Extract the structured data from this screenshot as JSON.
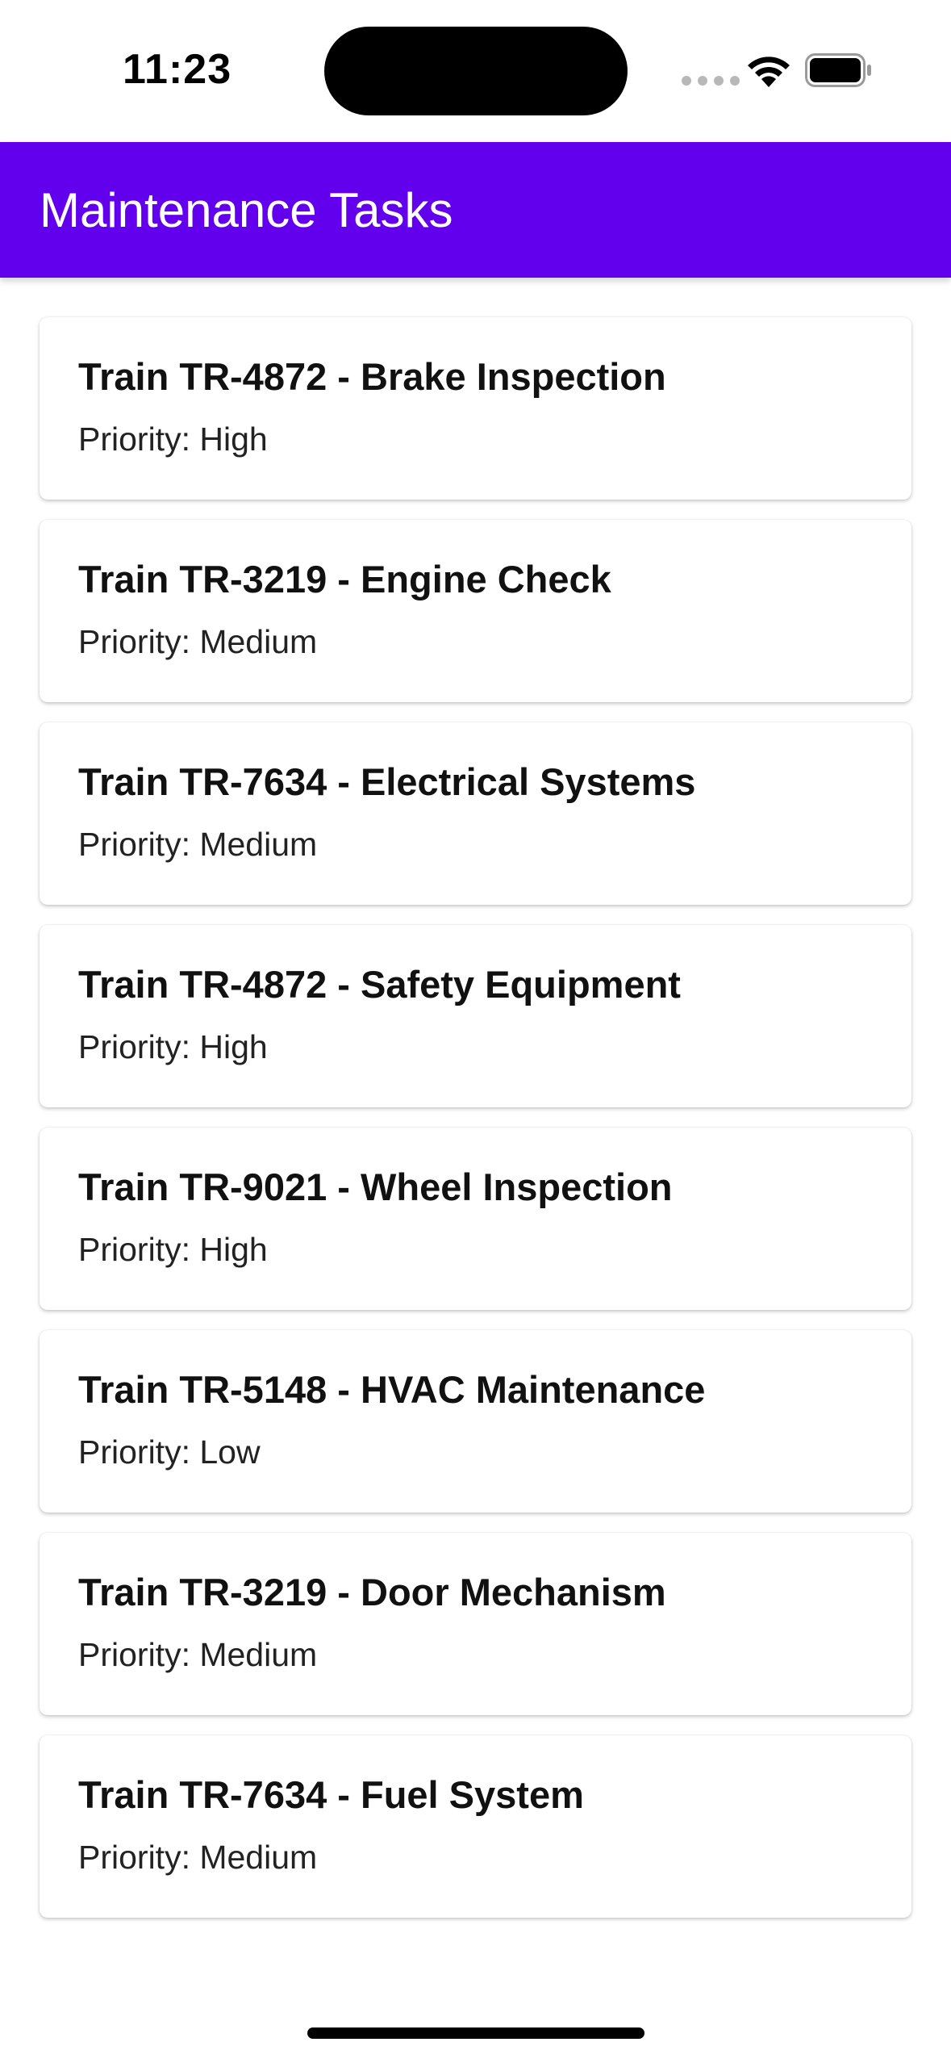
{
  "status_bar": {
    "time": "11:23",
    "icons": [
      "signal-dots-icon",
      "wifi-icon",
      "battery-icon"
    ]
  },
  "app_bar": {
    "title": "Maintenance Tasks",
    "color": "#6200ee"
  },
  "tasks": [
    {
      "title": "Train TR-4872 - Brake Inspection",
      "priority": "Priority: High"
    },
    {
      "title": "Train TR-3219 - Engine Check",
      "priority": "Priority: Medium"
    },
    {
      "title": "Train TR-7634 - Electrical Systems",
      "priority": "Priority: Medium"
    },
    {
      "title": "Train TR-4872 - Safety Equipment",
      "priority": "Priority: High"
    },
    {
      "title": "Train TR-9021 - Wheel Inspection",
      "priority": "Priority: High"
    },
    {
      "title": "Train TR-5148 - HVAC Maintenance",
      "priority": "Priority: Low"
    },
    {
      "title": "Train TR-3219 - Door Mechanism",
      "priority": "Priority: Medium"
    },
    {
      "title": "Train TR-7634 - Fuel System",
      "priority": "Priority: Medium"
    }
  ]
}
